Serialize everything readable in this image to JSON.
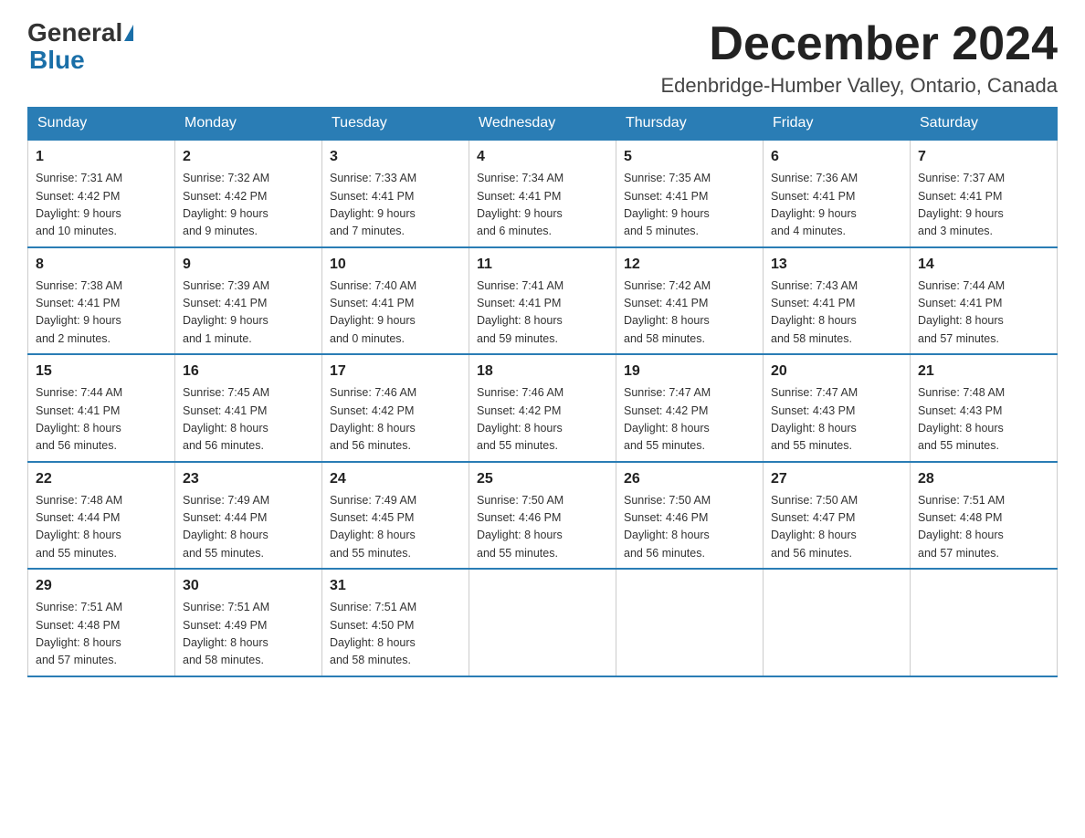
{
  "header": {
    "logo_general": "General",
    "logo_blue": "Blue",
    "month_title": "December 2024",
    "subtitle": "Edenbridge-Humber Valley, Ontario, Canada"
  },
  "days_of_week": [
    "Sunday",
    "Monday",
    "Tuesday",
    "Wednesday",
    "Thursday",
    "Friday",
    "Saturday"
  ],
  "weeks": [
    [
      {
        "day": "1",
        "sunrise": "Sunrise: 7:31 AM",
        "sunset": "Sunset: 4:42 PM",
        "daylight": "Daylight: 9 hours",
        "daylight2": "and 10 minutes."
      },
      {
        "day": "2",
        "sunrise": "Sunrise: 7:32 AM",
        "sunset": "Sunset: 4:42 PM",
        "daylight": "Daylight: 9 hours",
        "daylight2": "and 9 minutes."
      },
      {
        "day": "3",
        "sunrise": "Sunrise: 7:33 AM",
        "sunset": "Sunset: 4:41 PM",
        "daylight": "Daylight: 9 hours",
        "daylight2": "and 7 minutes."
      },
      {
        "day": "4",
        "sunrise": "Sunrise: 7:34 AM",
        "sunset": "Sunset: 4:41 PM",
        "daylight": "Daylight: 9 hours",
        "daylight2": "and 6 minutes."
      },
      {
        "day": "5",
        "sunrise": "Sunrise: 7:35 AM",
        "sunset": "Sunset: 4:41 PM",
        "daylight": "Daylight: 9 hours",
        "daylight2": "and 5 minutes."
      },
      {
        "day": "6",
        "sunrise": "Sunrise: 7:36 AM",
        "sunset": "Sunset: 4:41 PM",
        "daylight": "Daylight: 9 hours",
        "daylight2": "and 4 minutes."
      },
      {
        "day": "7",
        "sunrise": "Sunrise: 7:37 AM",
        "sunset": "Sunset: 4:41 PM",
        "daylight": "Daylight: 9 hours",
        "daylight2": "and 3 minutes."
      }
    ],
    [
      {
        "day": "8",
        "sunrise": "Sunrise: 7:38 AM",
        "sunset": "Sunset: 4:41 PM",
        "daylight": "Daylight: 9 hours",
        "daylight2": "and 2 minutes."
      },
      {
        "day": "9",
        "sunrise": "Sunrise: 7:39 AM",
        "sunset": "Sunset: 4:41 PM",
        "daylight": "Daylight: 9 hours",
        "daylight2": "and 1 minute."
      },
      {
        "day": "10",
        "sunrise": "Sunrise: 7:40 AM",
        "sunset": "Sunset: 4:41 PM",
        "daylight": "Daylight: 9 hours",
        "daylight2": "and 0 minutes."
      },
      {
        "day": "11",
        "sunrise": "Sunrise: 7:41 AM",
        "sunset": "Sunset: 4:41 PM",
        "daylight": "Daylight: 8 hours",
        "daylight2": "and 59 minutes."
      },
      {
        "day": "12",
        "sunrise": "Sunrise: 7:42 AM",
        "sunset": "Sunset: 4:41 PM",
        "daylight": "Daylight: 8 hours",
        "daylight2": "and 58 minutes."
      },
      {
        "day": "13",
        "sunrise": "Sunrise: 7:43 AM",
        "sunset": "Sunset: 4:41 PM",
        "daylight": "Daylight: 8 hours",
        "daylight2": "and 58 minutes."
      },
      {
        "day": "14",
        "sunrise": "Sunrise: 7:44 AM",
        "sunset": "Sunset: 4:41 PM",
        "daylight": "Daylight: 8 hours",
        "daylight2": "and 57 minutes."
      }
    ],
    [
      {
        "day": "15",
        "sunrise": "Sunrise: 7:44 AM",
        "sunset": "Sunset: 4:41 PM",
        "daylight": "Daylight: 8 hours",
        "daylight2": "and 56 minutes."
      },
      {
        "day": "16",
        "sunrise": "Sunrise: 7:45 AM",
        "sunset": "Sunset: 4:41 PM",
        "daylight": "Daylight: 8 hours",
        "daylight2": "and 56 minutes."
      },
      {
        "day": "17",
        "sunrise": "Sunrise: 7:46 AM",
        "sunset": "Sunset: 4:42 PM",
        "daylight": "Daylight: 8 hours",
        "daylight2": "and 56 minutes."
      },
      {
        "day": "18",
        "sunrise": "Sunrise: 7:46 AM",
        "sunset": "Sunset: 4:42 PM",
        "daylight": "Daylight: 8 hours",
        "daylight2": "and 55 minutes."
      },
      {
        "day": "19",
        "sunrise": "Sunrise: 7:47 AM",
        "sunset": "Sunset: 4:42 PM",
        "daylight": "Daylight: 8 hours",
        "daylight2": "and 55 minutes."
      },
      {
        "day": "20",
        "sunrise": "Sunrise: 7:47 AM",
        "sunset": "Sunset: 4:43 PM",
        "daylight": "Daylight: 8 hours",
        "daylight2": "and 55 minutes."
      },
      {
        "day": "21",
        "sunrise": "Sunrise: 7:48 AM",
        "sunset": "Sunset: 4:43 PM",
        "daylight": "Daylight: 8 hours",
        "daylight2": "and 55 minutes."
      }
    ],
    [
      {
        "day": "22",
        "sunrise": "Sunrise: 7:48 AM",
        "sunset": "Sunset: 4:44 PM",
        "daylight": "Daylight: 8 hours",
        "daylight2": "and 55 minutes."
      },
      {
        "day": "23",
        "sunrise": "Sunrise: 7:49 AM",
        "sunset": "Sunset: 4:44 PM",
        "daylight": "Daylight: 8 hours",
        "daylight2": "and 55 minutes."
      },
      {
        "day": "24",
        "sunrise": "Sunrise: 7:49 AM",
        "sunset": "Sunset: 4:45 PM",
        "daylight": "Daylight: 8 hours",
        "daylight2": "and 55 minutes."
      },
      {
        "day": "25",
        "sunrise": "Sunrise: 7:50 AM",
        "sunset": "Sunset: 4:46 PM",
        "daylight": "Daylight: 8 hours",
        "daylight2": "and 55 minutes."
      },
      {
        "day": "26",
        "sunrise": "Sunrise: 7:50 AM",
        "sunset": "Sunset: 4:46 PM",
        "daylight": "Daylight: 8 hours",
        "daylight2": "and 56 minutes."
      },
      {
        "day": "27",
        "sunrise": "Sunrise: 7:50 AM",
        "sunset": "Sunset: 4:47 PM",
        "daylight": "Daylight: 8 hours",
        "daylight2": "and 56 minutes."
      },
      {
        "day": "28",
        "sunrise": "Sunrise: 7:51 AM",
        "sunset": "Sunset: 4:48 PM",
        "daylight": "Daylight: 8 hours",
        "daylight2": "and 57 minutes."
      }
    ],
    [
      {
        "day": "29",
        "sunrise": "Sunrise: 7:51 AM",
        "sunset": "Sunset: 4:48 PM",
        "daylight": "Daylight: 8 hours",
        "daylight2": "and 57 minutes."
      },
      {
        "day": "30",
        "sunrise": "Sunrise: 7:51 AM",
        "sunset": "Sunset: 4:49 PM",
        "daylight": "Daylight: 8 hours",
        "daylight2": "and 58 minutes."
      },
      {
        "day": "31",
        "sunrise": "Sunrise: 7:51 AM",
        "sunset": "Sunset: 4:50 PM",
        "daylight": "Daylight: 8 hours",
        "daylight2": "and 58 minutes."
      },
      null,
      null,
      null,
      null
    ]
  ]
}
